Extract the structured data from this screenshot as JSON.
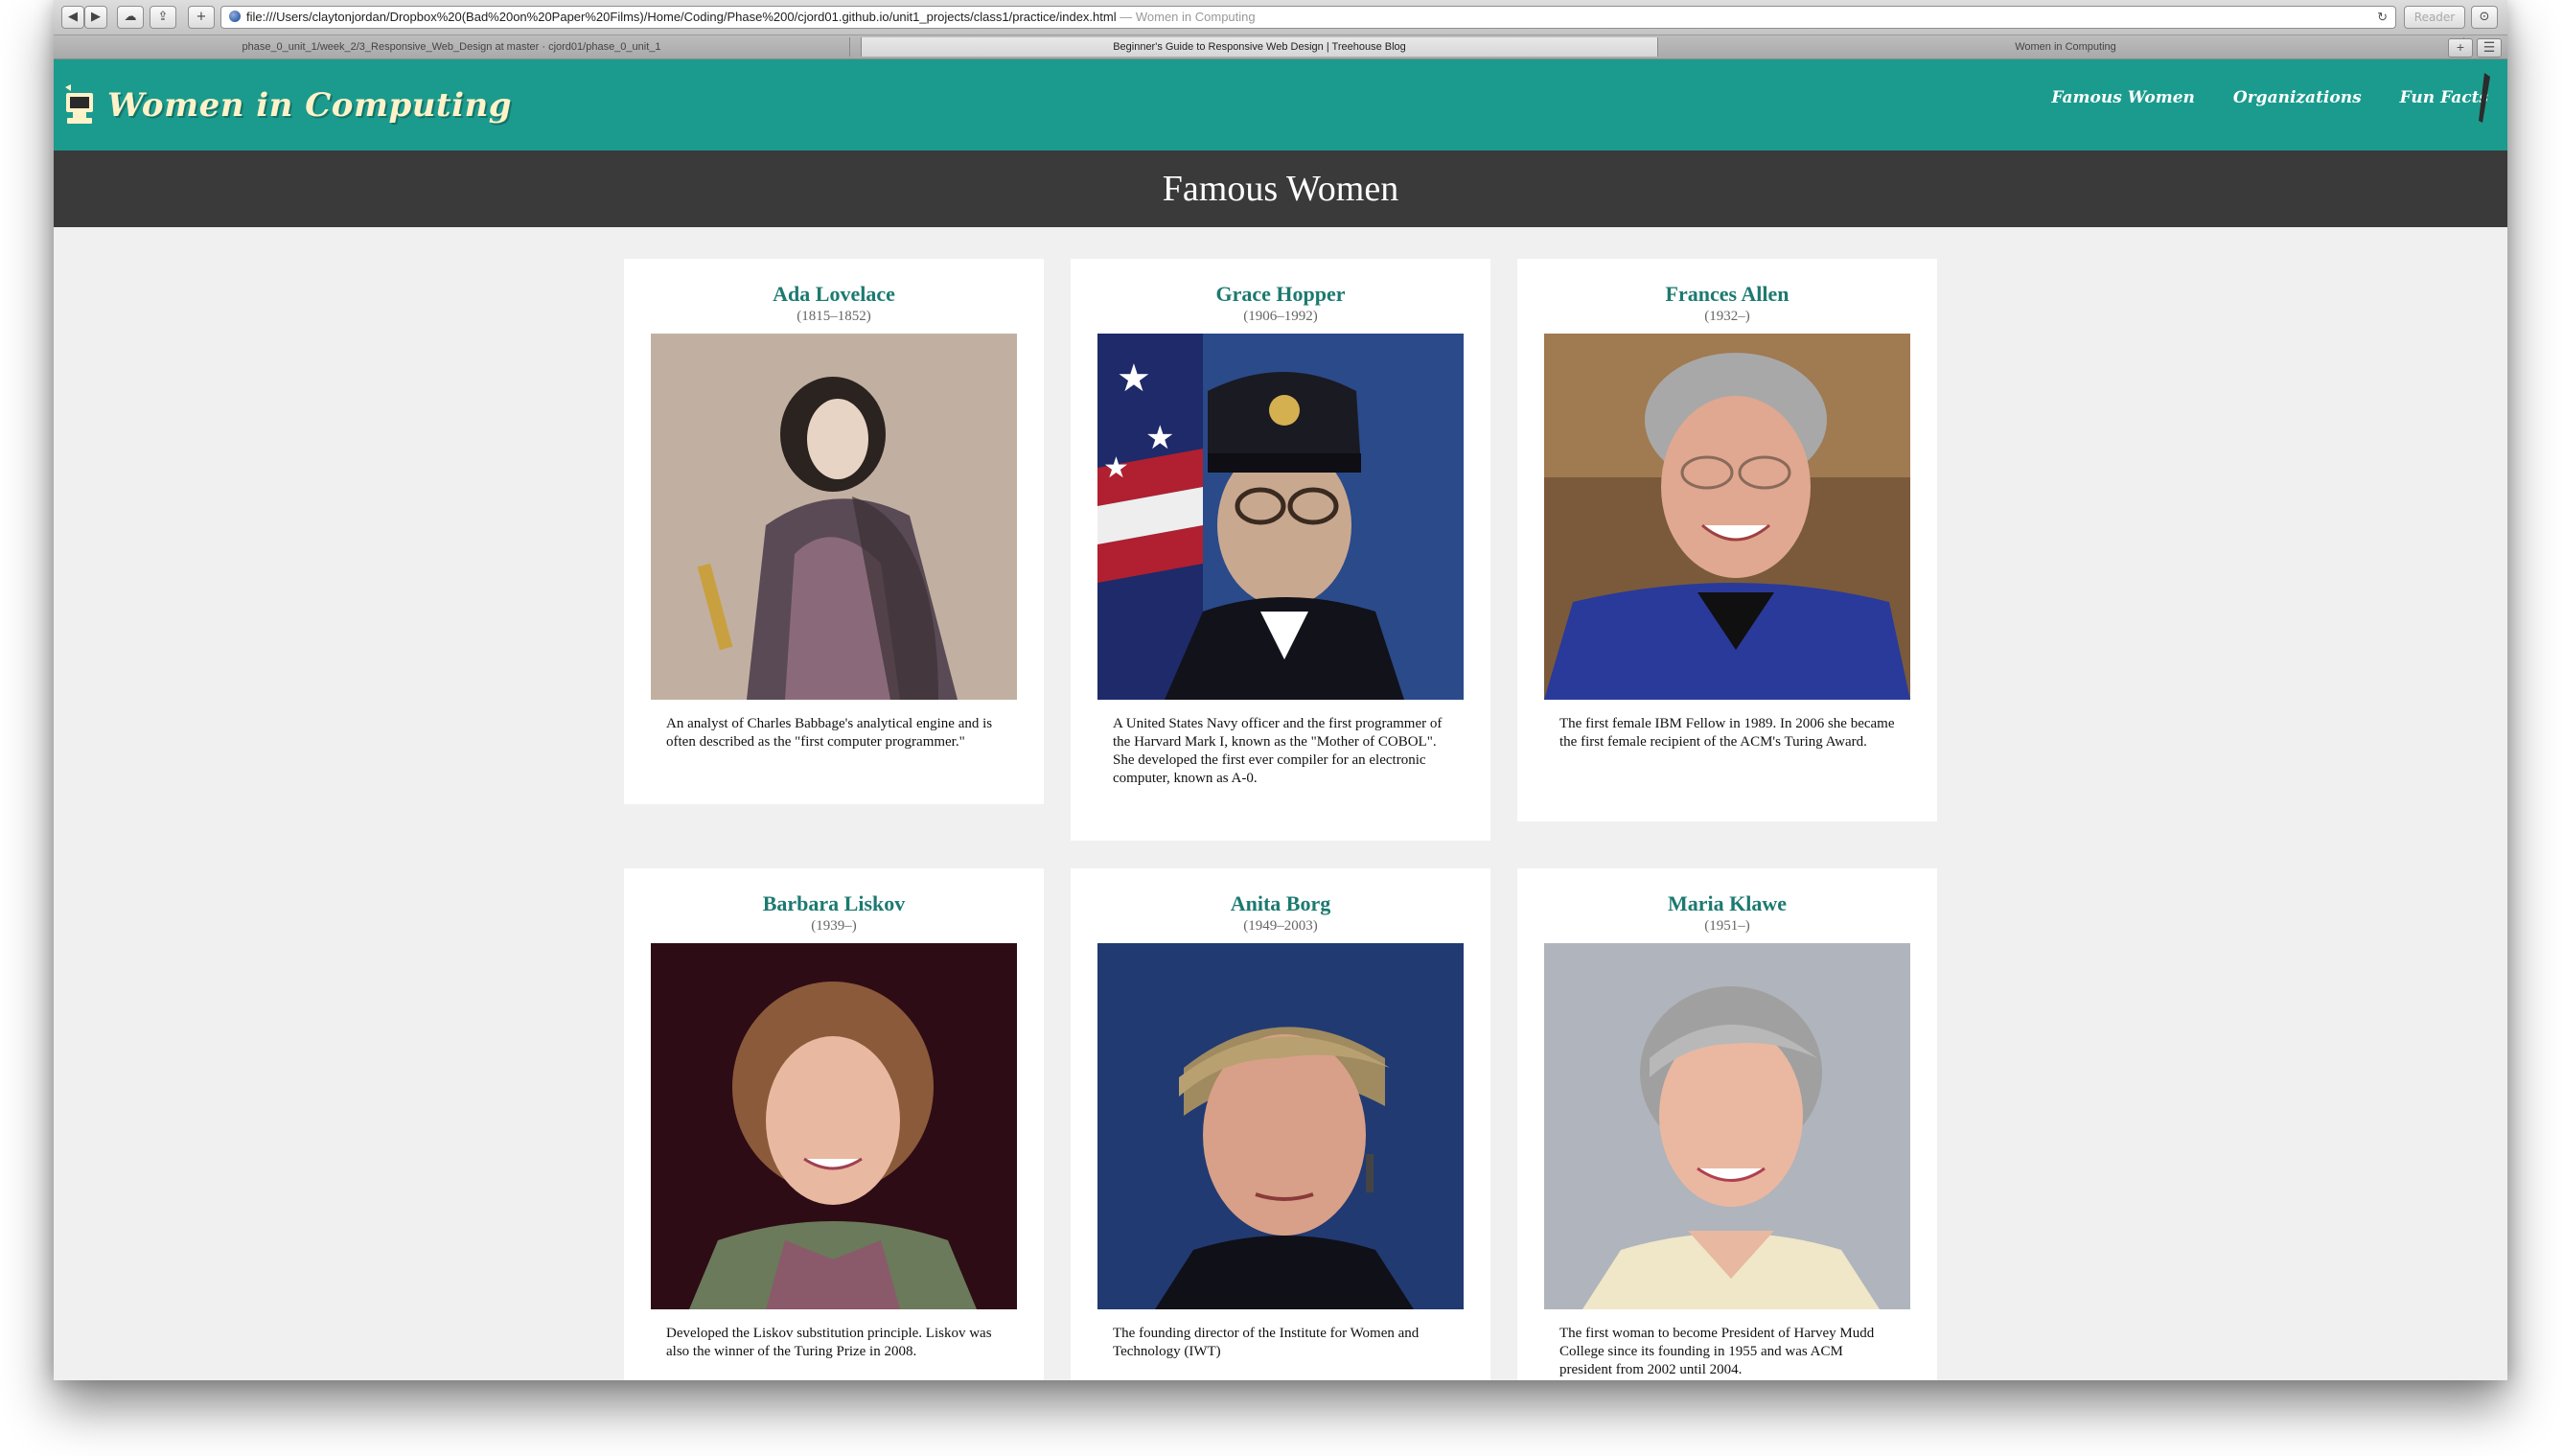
{
  "browser": {
    "url": "file:///Users/claytonjordan/Dropbox%20(Bad%20on%20Paper%20Films)/Home/Coding/Phase%200/cjord01.github.io/unit1_projects/class1/practice/index.html",
    "page_title": "— Women in Computing",
    "reader_label": "Reader",
    "tabs": [
      {
        "label": "phase_0_unit_1/week_2/3_Responsive_Web_Design at master · cjord01/phase_0_unit_1"
      },
      {
        "label": "Beginner's Guide to Responsive Web Design | Treehouse Blog"
      },
      {
        "label": "Women in Computing"
      }
    ]
  },
  "site": {
    "logo_text": "Women in Computing",
    "nav": [
      "Famous Women",
      "Organizations",
      "Fun Facts"
    ],
    "hero_title": "Famous Women"
  },
  "cards": [
    {
      "name": "Ada Lovelace",
      "years": "(1815–1852)",
      "desc": "An analyst of Charles Babbage's analytical engine and is often described as the \"first computer programmer.\""
    },
    {
      "name": "Grace Hopper",
      "years": "(1906–1992)",
      "desc": "A United States Navy officer and the first programmer of the Harvard Mark I, known as the \"Mother of COBOL\". She developed the first ever compiler for an electronic computer, known as A-0."
    },
    {
      "name": "Frances Allen",
      "years": "(1932–)",
      "desc": "The first female IBM Fellow in 1989. In 2006 she became the first female recipient of the ACM's Turing Award."
    },
    {
      "name": "Barbara Liskov",
      "years": "(1939–)",
      "desc": "Developed the Liskov substitution principle. Liskov was also the winner of the Turing Prize in 2008."
    },
    {
      "name": "Anita Borg",
      "years": "(1949–2003)",
      "desc": "The founding director of the Institute for Women and Technology (IWT)"
    },
    {
      "name": "Maria Klawe",
      "years": "(1951–)",
      "desc": "The first woman to become President of Harvey Mudd College since its founding in 1955 and was ACM president from 2002 until 2004."
    }
  ],
  "colors": {
    "header": "#1b9b8e",
    "hero": "#3a3a3a",
    "name_text": "#1c7a70",
    "page_bg": "#f0f0f0"
  }
}
